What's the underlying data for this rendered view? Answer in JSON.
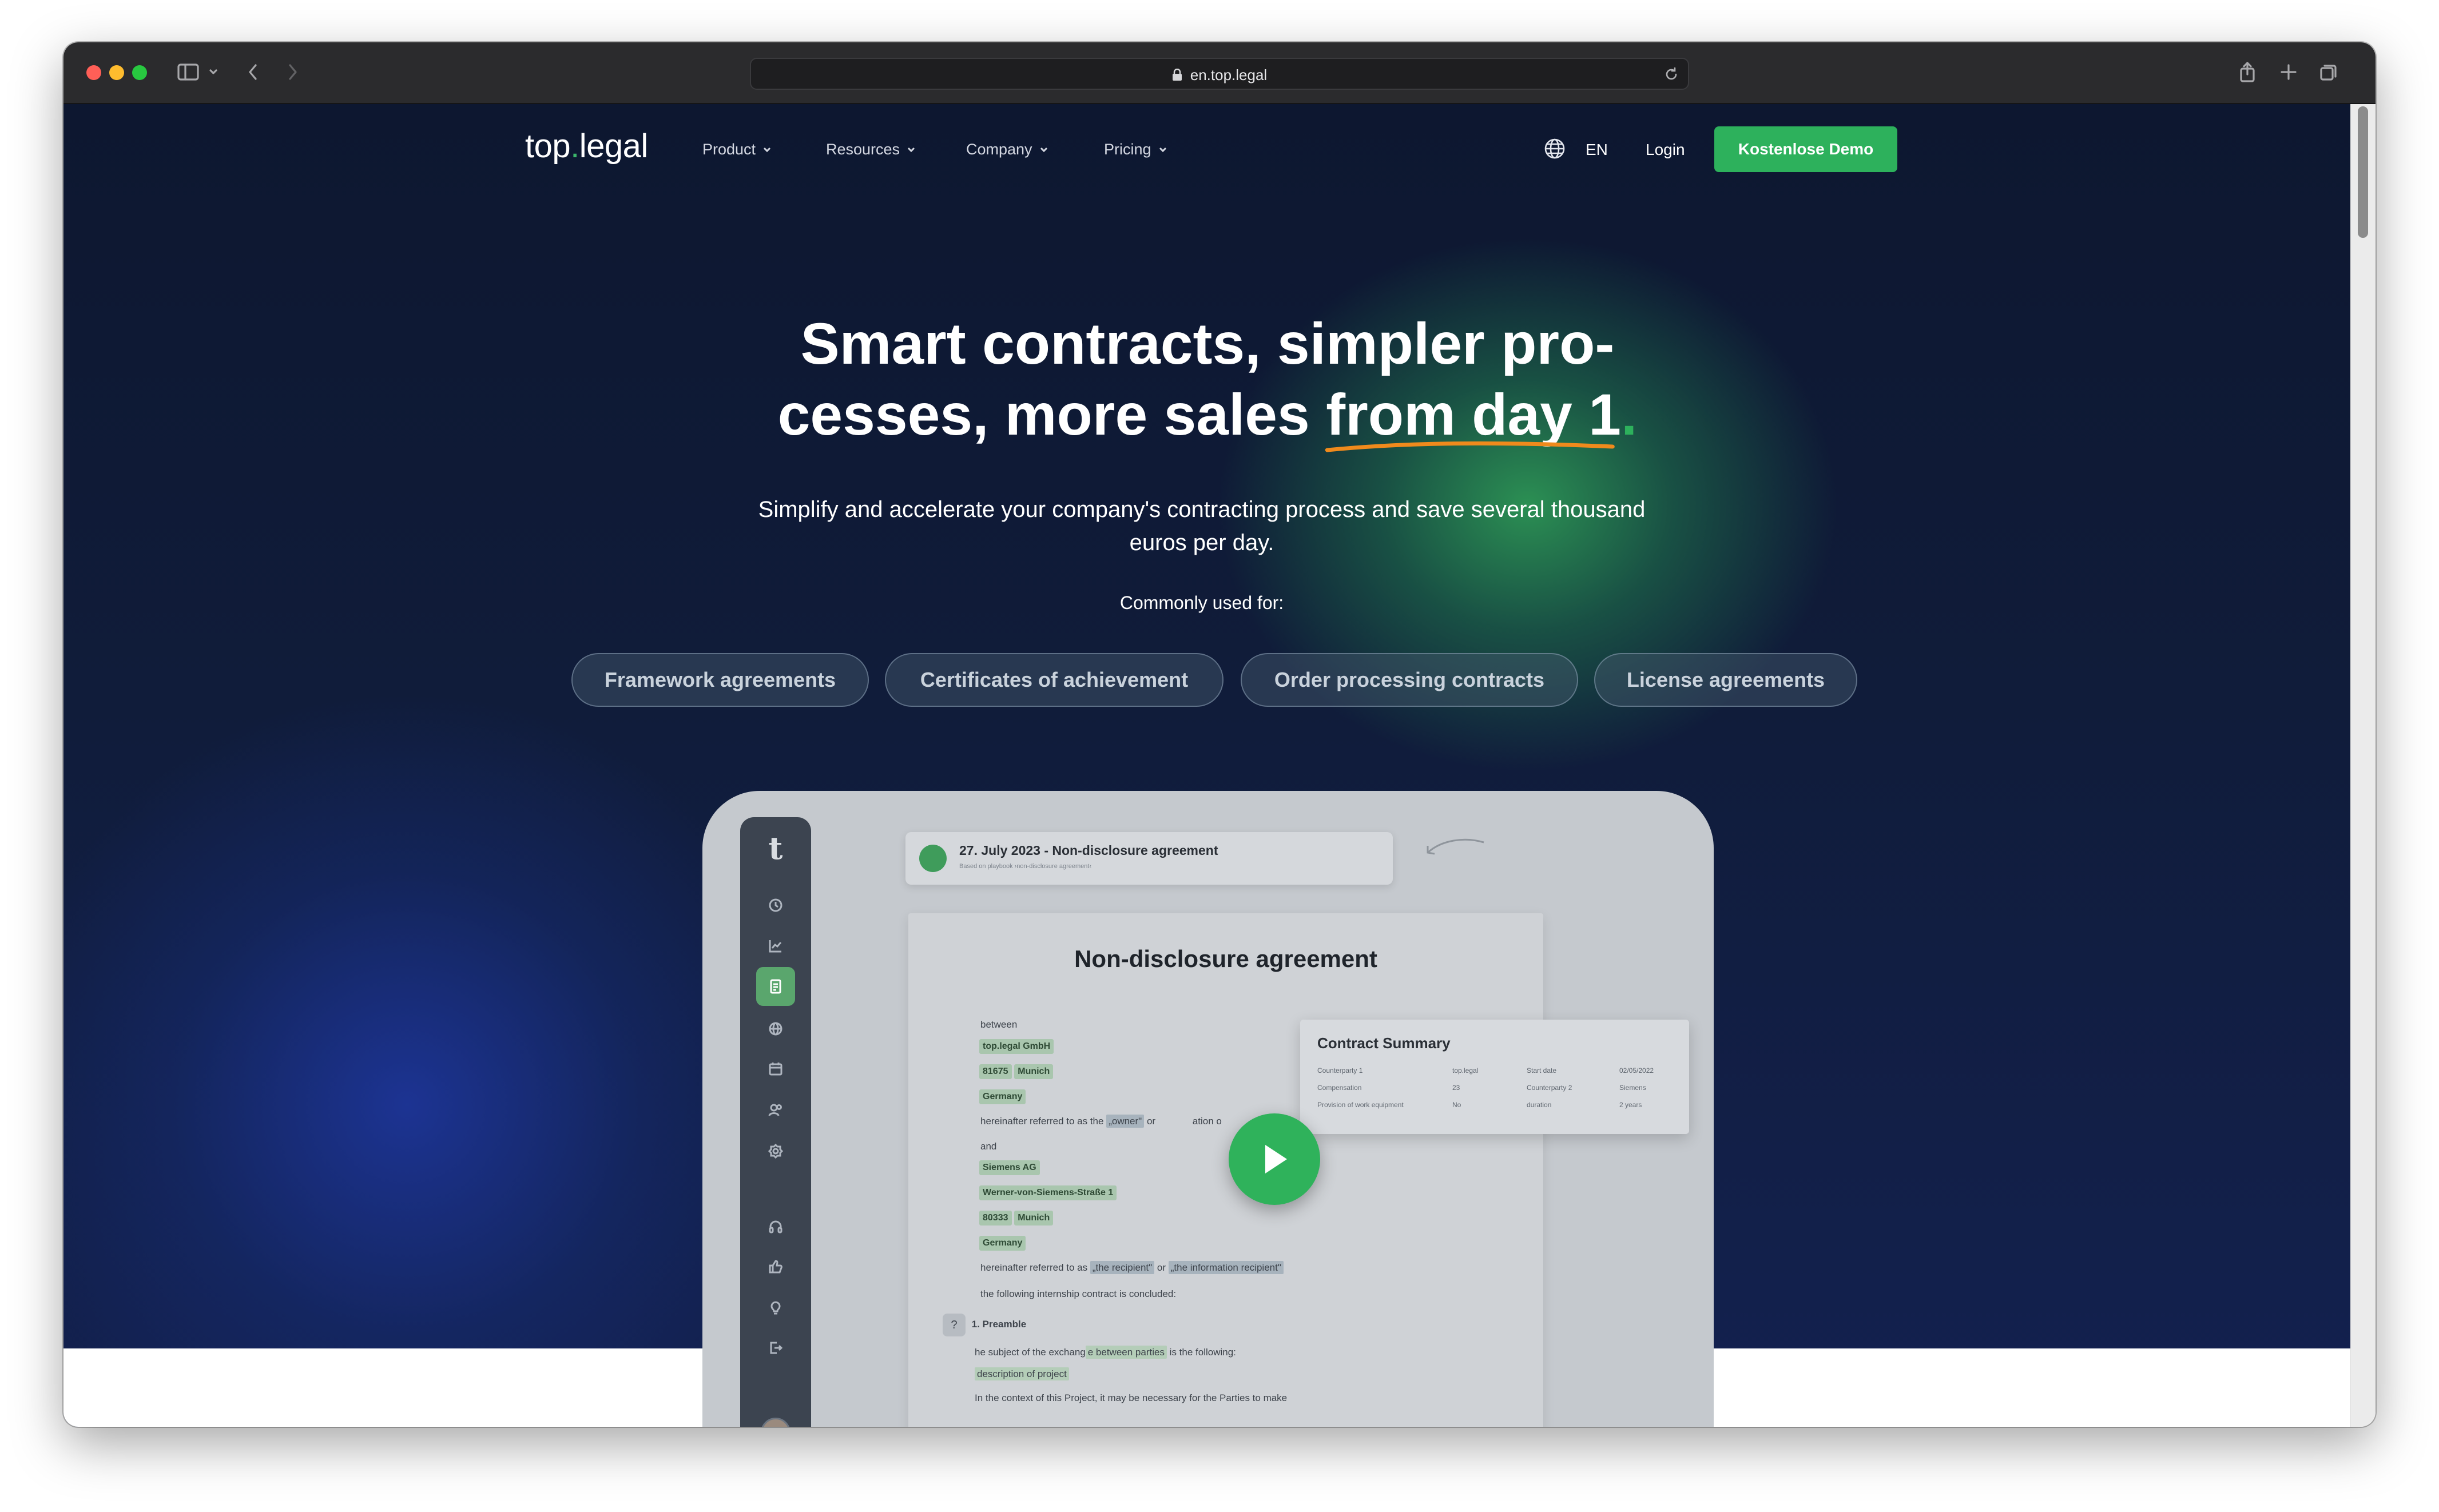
{
  "browser": {
    "url": "en.top.legal"
  },
  "nav": {
    "logo_prefix": "top",
    "logo_dot": ".",
    "logo_suffix": "legal",
    "items": [
      {
        "label": "Product"
      },
      {
        "label": "Resources"
      },
      {
        "label": "Company"
      },
      {
        "label": "Pricing"
      }
    ],
    "language": "EN",
    "login": "Login",
    "cta": "Kostenlose Demo"
  },
  "hero": {
    "headline_line1": "Smart contracts, simpler pro-",
    "headline_line2_start": "cesses, more sales ",
    "headline_highlight": "from day 1",
    "headline_period": ".",
    "subtitle": "Simplify and accelerate your company's contracting process and save several thousand euros per day.",
    "commonly_used_for": "Commonly used for:",
    "pills": [
      "Framework agreements",
      "Certificates of achievement",
      "Order processing contracts",
      "License agreements"
    ]
  },
  "mockup": {
    "logo": "t",
    "top_card_title": "27. July 2023 - Non-disclosure agreement",
    "top_card_sub": "Based on playbook ›non-disclosure agreement‹",
    "doc_title": "Non-disclosure agreement",
    "between": "between",
    "party1_name": "top.legal GmbH",
    "party1_zip": "81675",
    "party1_city": "Munich",
    "party1_country": "Germany",
    "referred_owner_pre": "hereinafter referred to as  the",
    "referred_owner_tag": "„owner\"",
    "referred_owner_post": "or",
    "referred_owner_tail": "ation o",
    "and": "and",
    "party2_name": "Siemens AG",
    "party2_street": "Werner-von-Siemens-Straße 1",
    "party2_zip": "80333",
    "party2_city": "Munich",
    "party2_country": "Germany",
    "referred_recipient_pre": "hereinafter referred to as",
    "referred_recipient_tag1": "„the recipient\"",
    "referred_recipient_mid": "or",
    "referred_recipient_tag2": "„the information recipient\"",
    "concluded": "the following internship contract is concluded:",
    "preamble": "1. Preamble",
    "preamble_text_pre": "he subject of the exchang",
    "preamble_text_hl": "e between parties",
    "preamble_text_post": " is the following:",
    "description_tag": "description of project",
    "context_text": "In the context of this Project, it may be necessary for the Parties to make",
    "summary": {
      "title": "Contract Summary",
      "rows": [
        {
          "k1": "Counterparty 1",
          "v1": "top.legal",
          "k2": "Start date",
          "v2": "02/05/2022"
        },
        {
          "k1": "Compensation",
          "v1": "23",
          "k2": "Counterparty 2",
          "v2": "Siemens"
        },
        {
          "k1": "Provision of work equipment",
          "v1": "No",
          "k2": "duration",
          "v2": "2 years"
        }
      ]
    }
  },
  "colors": {
    "accent": "#2db15c",
    "page_bg": "#101c3a",
    "underline": "#f08a1c"
  }
}
